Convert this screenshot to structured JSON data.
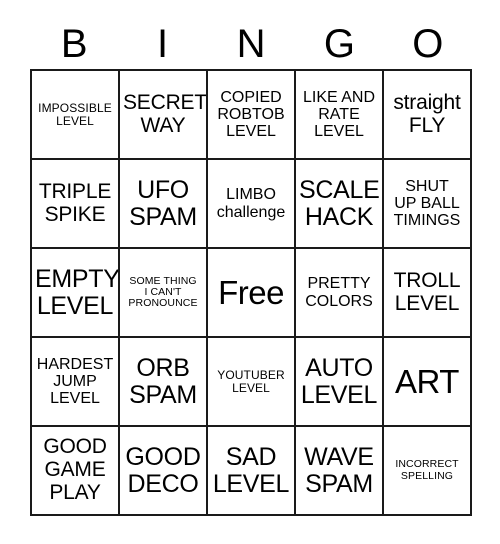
{
  "card": {
    "header_letters": [
      "B",
      "I",
      "N",
      "G",
      "O"
    ],
    "free_space_label": "Free",
    "rows": [
      [
        {
          "text": "IMPOSSIBLE\nLEVEL",
          "size": "xs"
        },
        {
          "text": "SECRET\nWAY",
          "size": "md"
        },
        {
          "text": "COPIED\nROBTOB\nLEVEL",
          "size": "sm"
        },
        {
          "text": "LIKE AND\nRATE\nLEVEL",
          "size": "sm"
        },
        {
          "text": "straight\nFLY",
          "size": "md"
        }
      ],
      [
        {
          "text": "TRIPLE\nSPIKE",
          "size": "md"
        },
        {
          "text": "UFO\nSPAM",
          "size": "lg"
        },
        {
          "text": "LIMBO\nchallenge",
          "size": "sm"
        },
        {
          "text": "SCALE\nHACK",
          "size": "lg"
        },
        {
          "text": "SHUT\nUP BALL\nTIMINGS",
          "size": "sm"
        }
      ],
      [
        {
          "text": "EMPTY\nLEVEL",
          "size": "lg"
        },
        {
          "text": "SOME THING\nI CAN'T\nPRONOUNCE",
          "size": "xxs"
        },
        {
          "text": "Free",
          "size": "xl"
        },
        {
          "text": "PRETTY\nCOLORS",
          "size": "sm"
        },
        {
          "text": "TROLL\nLEVEL",
          "size": "md"
        }
      ],
      [
        {
          "text": "HARDEST\nJUMP\nLEVEL",
          "size": "sm"
        },
        {
          "text": "ORB\nSPAM",
          "size": "lg"
        },
        {
          "text": "YOUTUBER\nLEVEL",
          "size": "xs"
        },
        {
          "text": "AUTO\nLEVEL",
          "size": "lg"
        },
        {
          "text": "ART",
          "size": "xl"
        }
      ],
      [
        {
          "text": "GOOD\nGAME\nPLAY",
          "size": "md"
        },
        {
          "text": "GOOD\nDECO",
          "size": "lg"
        },
        {
          "text": "SAD\nLEVEL",
          "size": "lg"
        },
        {
          "text": "WAVE\nSPAM",
          "size": "lg"
        },
        {
          "text": "INCORRECT\nSPELLING",
          "size": "xxs"
        }
      ]
    ]
  },
  "colors": {
    "background": "#ffffff",
    "grid_line": "#1a1a1a",
    "text": "#000000"
  }
}
